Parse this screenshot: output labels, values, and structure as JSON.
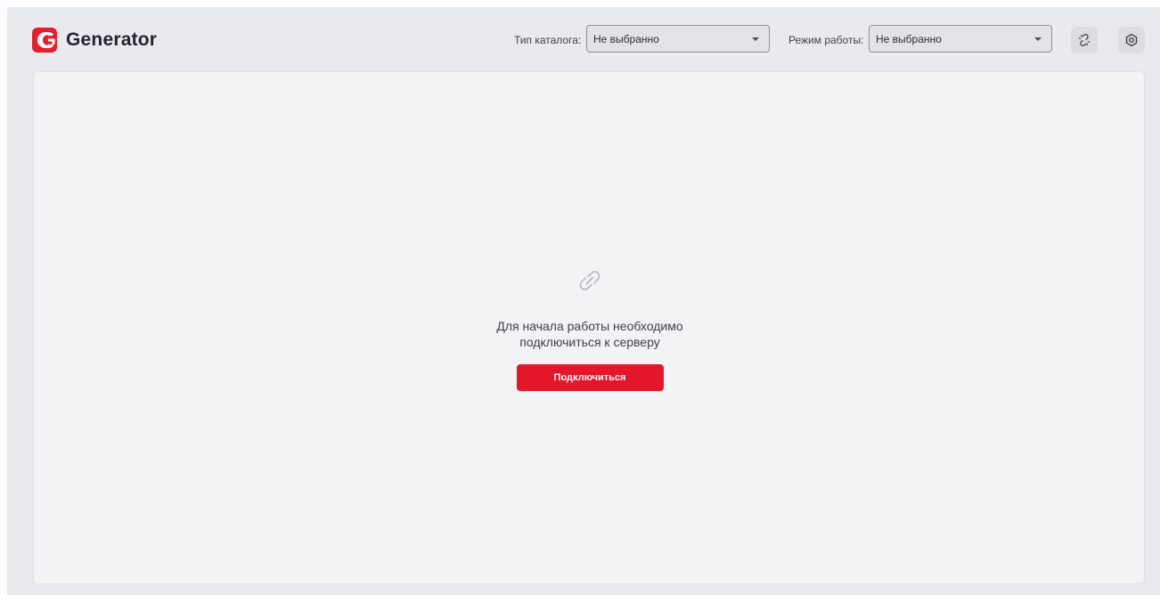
{
  "app": {
    "name": "Generator",
    "brand_color": "#e3202e"
  },
  "header": {
    "catalog_type": {
      "label": "Тип каталога:",
      "value": "Не выбранно"
    },
    "work_mode": {
      "label": "Режим работы:",
      "value": "Не выбранно"
    },
    "icons": {
      "connection": "broken-link-icon",
      "settings": "settings-gear-icon"
    }
  },
  "empty_state": {
    "icon": "link-icon",
    "line1": "Для начала работы необходимо",
    "line2": "подключиться к серверу",
    "button_label": "Подключиться",
    "button_color": "#e3162a"
  }
}
